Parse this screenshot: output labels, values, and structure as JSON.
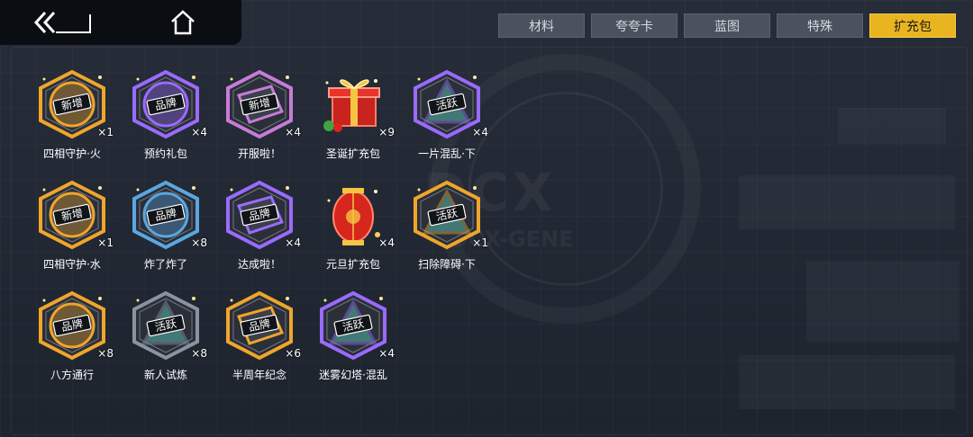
{
  "nav": {
    "back_icon": "double-chevron-back-icon",
    "home_icon": "home-icon"
  },
  "tabs": [
    {
      "label": "材料",
      "active": false
    },
    {
      "label": "夸夸卡",
      "active": false
    },
    {
      "label": "蓝图",
      "active": false
    },
    {
      "label": "特殊",
      "active": false
    },
    {
      "label": "扩充包",
      "active": true
    }
  ],
  "background": {
    "logo_text": "DCX",
    "logo_sub": "DCX-GENE"
  },
  "items": [
    {
      "name": "四相守护·火",
      "count": "×1",
      "badge": "新增",
      "frame": "hex",
      "color": "#f0a52b",
      "variant": "round"
    },
    {
      "name": "预约礼包",
      "count": "×4",
      "badge": "品牌",
      "frame": "hex",
      "color": "#9a6bff",
      "variant": "round"
    },
    {
      "name": "开服啦！",
      "count": "×4",
      "badge": "新增",
      "frame": "hex",
      "color": "#c77bd8",
      "variant": "box"
    },
    {
      "name": "圣诞扩充包",
      "count": "×9",
      "badge": "",
      "frame": "gift",
      "color": "#e8352a",
      "variant": "gift"
    },
    {
      "name": "一片混乱·下",
      "count": "×4",
      "badge": "活跃",
      "frame": "hex",
      "color": "#9a6bff",
      "variant": "tri"
    },
    {
      "name": "四相守护·水",
      "count": "×1",
      "badge": "新增",
      "frame": "hex",
      "color": "#f0a52b",
      "variant": "round"
    },
    {
      "name": "炸了炸了",
      "count": "×8",
      "badge": "品牌",
      "frame": "hex",
      "color": "#5aa7e0",
      "variant": "round"
    },
    {
      "name": "达成啦！",
      "count": "×4",
      "badge": "品牌",
      "frame": "hex",
      "color": "#9a6bff",
      "variant": "box"
    },
    {
      "name": "元旦扩充包",
      "count": "×4",
      "badge": "",
      "frame": "lantern",
      "color": "#e8352a",
      "variant": "lantern"
    },
    {
      "name": "扫除障碍·下",
      "count": "×1",
      "badge": "活跃",
      "frame": "hex",
      "color": "#f0a52b",
      "variant": "tri"
    },
    {
      "name": "八方通行",
      "count": "×8",
      "badge": "品牌",
      "frame": "hex",
      "color": "#f0a52b",
      "variant": "round"
    },
    {
      "name": "新人试炼",
      "count": "×8",
      "badge": "活跃",
      "frame": "hex",
      "color": "#8a93a0",
      "variant": "tri"
    },
    {
      "name": "半周年纪念",
      "count": "×6",
      "badge": "品牌",
      "frame": "hex",
      "color": "#f0a52b",
      "variant": "box"
    },
    {
      "name": "迷雾幻塔·混乱",
      "count": "×4",
      "badge": "活跃",
      "frame": "hex",
      "color": "#9a6bff",
      "variant": "tri"
    }
  ]
}
